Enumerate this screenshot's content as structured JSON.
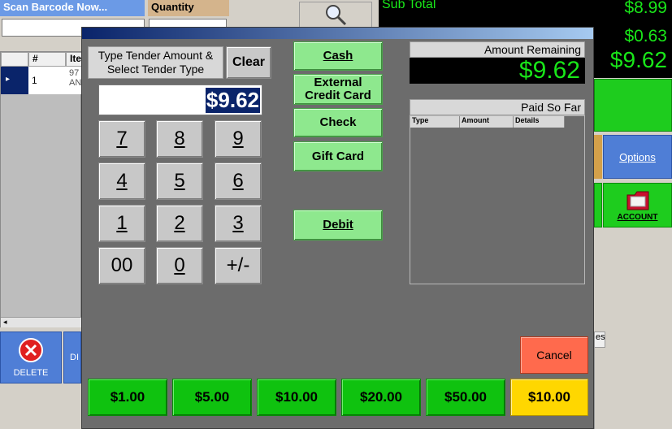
{
  "background": {
    "scan_label": "Scan Barcode Now...",
    "quantity_label": "Quantity",
    "grid_headers": [
      "#",
      "Ite"
    ],
    "grid_row": {
      "num": "1",
      "item_line1": "97",
      "item_line2": "AN"
    },
    "subtotal_label": "Sub Total",
    "totals": [
      "$8.99",
      "$0.63",
      "$9.62"
    ],
    "options_label": "Options",
    "account_label": "ACCOUNT",
    "delete_label": "DELETE",
    "di_label": "DI",
    "es_label": "es"
  },
  "dialog": {
    "instruction": "Type Tender Amount & Select Tender Type",
    "clear_label": "Clear",
    "amount_value": "$9.62",
    "keypad": [
      "7",
      "8",
      "9",
      "4",
      "5",
      "6",
      "1",
      "2",
      "3",
      "00",
      "0",
      "+/-"
    ],
    "tender_buttons": {
      "cash": "Cash",
      "external_credit_line1": "External",
      "external_credit_line2": "Credit Card",
      "check": "Check",
      "gift_card": "Gift Card",
      "debit": "Debit"
    },
    "amount_remaining_label": "Amount Remaining",
    "amount_remaining_value": "$9.62",
    "paid_so_far_label": "Paid So Far",
    "paid_columns": [
      "Type",
      "Amount",
      "Details"
    ],
    "cancel_label": "Cancel",
    "quick_amounts": [
      "$1.00",
      "$5.00",
      "$10.00",
      "$20.00",
      "$50.00",
      "$10.00"
    ]
  },
  "colors": {
    "total_green": "#19e619",
    "tender_green": "#8ee88e",
    "quick_green": "#0fc20f",
    "quick_highlight": "#ffd700",
    "cancel_red": "#ff6a4d"
  }
}
